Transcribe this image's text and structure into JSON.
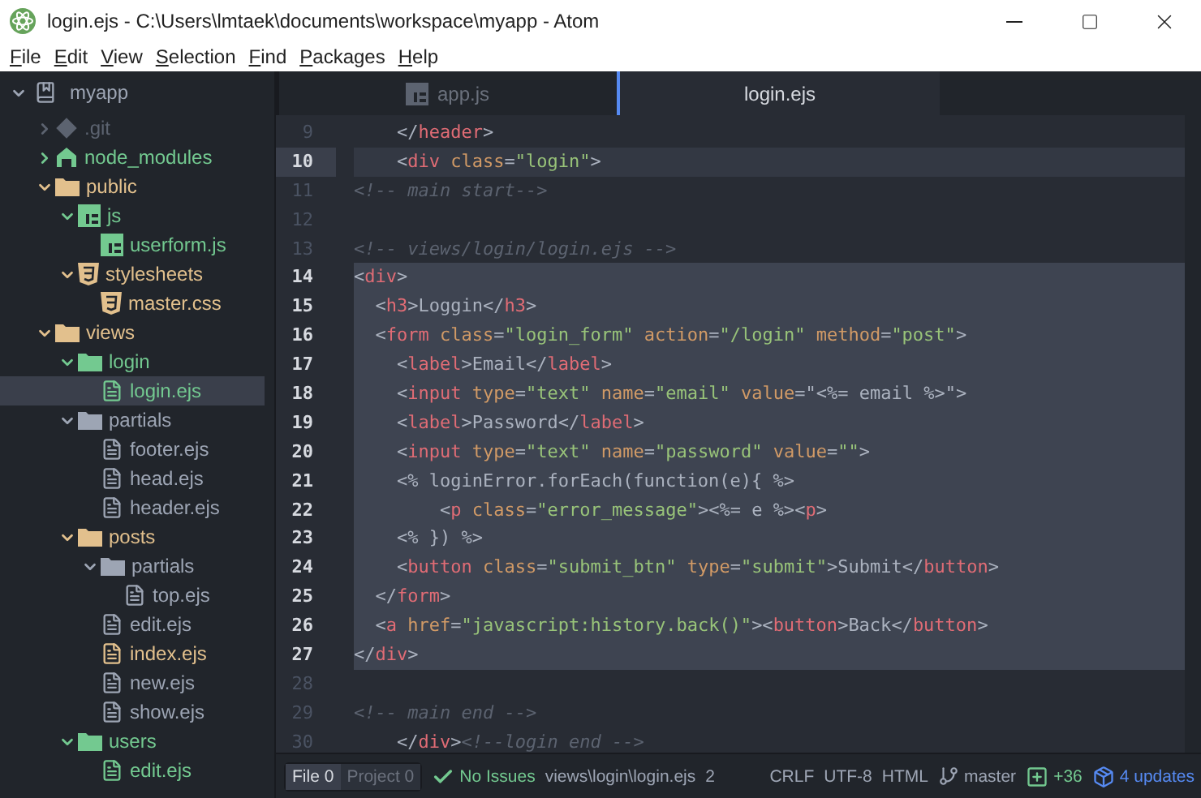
{
  "window": {
    "title": "login.ejs - C:\\Users\\lmtaek\\documents\\workspace\\myapp - Atom"
  },
  "menu": [
    "File",
    "Edit",
    "View",
    "Selection",
    "Find",
    "Packages",
    "Help"
  ],
  "tree": {
    "root": {
      "label": "myapp",
      "expanded": true,
      "selected": false
    },
    "items": [
      {
        "label": ".git",
        "kind": "git",
        "color": "#5c6370",
        "expanded": false,
        "selected": false
      },
      {
        "label": "node_modules",
        "kind": "modules",
        "color": "#73c990",
        "expanded": false,
        "selected": false
      },
      {
        "label": "public",
        "kind": "folder",
        "color": "#e2c08d",
        "expanded": true,
        "selected": false,
        "children": [
          {
            "label": "js",
            "kind": "scripts",
            "color": "#73c990",
            "expanded": true,
            "selected": false,
            "children": [
              {
                "label": "userform.js",
                "kind": "script",
                "color": "#73c990",
                "selected": false
              }
            ]
          },
          {
            "label": "stylesheets",
            "kind": "styles",
            "color": "#e2c08d",
            "expanded": true,
            "selected": false,
            "children": [
              {
                "label": "master.css",
                "kind": "stylesheet",
                "color": "#e2c08d",
                "selected": false
              }
            ]
          }
        ]
      },
      {
        "label": "views",
        "kind": "folder",
        "color": "#e2c08d",
        "expanded": true,
        "selected": false,
        "children": [
          {
            "label": "login",
            "kind": "folder",
            "color": "#73c990",
            "expanded": true,
            "selected": false,
            "children": [
              {
                "label": "login.ejs",
                "kind": "document",
                "color": "#73c990",
                "selected": true
              }
            ]
          },
          {
            "label": "partials",
            "kind": "folder",
            "color": "#9da5b4",
            "expanded": true,
            "selected": false,
            "children": [
              {
                "label": "footer.ejs",
                "kind": "document",
                "color": "#9da5b4",
                "selected": false
              },
              {
                "label": "head.ejs",
                "kind": "document",
                "color": "#9da5b4",
                "selected": false
              },
              {
                "label": "header.ejs",
                "kind": "document",
                "color": "#9da5b4",
                "selected": false
              }
            ]
          },
          {
            "label": "posts",
            "kind": "folder",
            "color": "#e2c08d",
            "expanded": true,
            "selected": false,
            "children": [
              {
                "label": "partials",
                "kind": "folder",
                "color": "#9da5b4",
                "expanded": true,
                "selected": false,
                "children": [
                  {
                    "label": "top.ejs",
                    "kind": "document",
                    "color": "#9da5b4",
                    "selected": false
                  }
                ]
              },
              {
                "label": "edit.ejs",
                "kind": "document",
                "color": "#9da5b4",
                "selected": false
              },
              {
                "label": "index.ejs",
                "kind": "document",
                "color": "#e2c08d",
                "selected": false
              },
              {
                "label": "new.ejs",
                "kind": "document",
                "color": "#9da5b4",
                "selected": false
              },
              {
                "label": "show.ejs",
                "kind": "document",
                "color": "#9da5b4",
                "selected": false
              }
            ]
          },
          {
            "label": "users",
            "kind": "folder",
            "color": "#73c990",
            "expanded": true,
            "selected": false,
            "children": [
              {
                "label": "edit.ejs",
                "kind": "document",
                "color": "#73c990",
                "selected": false
              }
            ]
          }
        ]
      }
    ]
  },
  "tabs": [
    {
      "label": "app.js",
      "kind": "script",
      "selected": false
    },
    {
      "label": "login.ejs",
      "kind": "document",
      "selected": true
    }
  ],
  "editor": {
    "lines": [
      {
        "number": "9",
        "cursor": false,
        "selected": false,
        "tokens": [
          {
            "kind": "punct",
            "text": "    </"
          },
          {
            "kind": "tag",
            "text": "header"
          },
          {
            "kind": "punct",
            "text": ">"
          }
        ]
      },
      {
        "number": "10",
        "cursor": true,
        "selected": false,
        "tokens": [
          {
            "kind": "punct",
            "text": "    <"
          },
          {
            "kind": "tag",
            "text": "div"
          },
          {
            "kind": "attr",
            "text": " class"
          },
          {
            "kind": "punct",
            "text": "="
          },
          {
            "kind": "string",
            "text": "\"login\""
          },
          {
            "kind": "punct",
            "text": ">"
          }
        ]
      },
      {
        "number": "11",
        "cursor": false,
        "selected": false,
        "tokens": [
          {
            "kind": "comment",
            "text": "<!-- main start-->"
          }
        ]
      },
      {
        "number": "12",
        "cursor": false,
        "selected": false
      },
      {
        "number": "13",
        "cursor": false,
        "selected": false,
        "tokens": [
          {
            "kind": "comment",
            "text": "<!-- views/login/login.ejs -->"
          }
        ]
      },
      {
        "number": "14",
        "cursor": false,
        "selected": true,
        "tokens": [
          {
            "kind": "punct",
            "text": "<"
          },
          {
            "kind": "tag",
            "text": "div"
          },
          {
            "kind": "punct",
            "text": ">"
          }
        ]
      },
      {
        "number": "15",
        "cursor": false,
        "selected": true,
        "tokens": [
          {
            "kind": "punct",
            "text": "  <"
          },
          {
            "kind": "tag",
            "text": "h3"
          },
          {
            "kind": "punct",
            "text": ">"
          },
          {
            "kind": "text",
            "text": "Loggin"
          },
          {
            "kind": "punct",
            "text": "</"
          },
          {
            "kind": "tag",
            "text": "h3"
          },
          {
            "kind": "punct",
            "text": ">"
          }
        ]
      },
      {
        "number": "16",
        "cursor": false,
        "selected": true,
        "tokens": [
          {
            "kind": "punct",
            "text": "  <"
          },
          {
            "kind": "tag",
            "text": "form"
          },
          {
            "kind": "attr",
            "text": " class"
          },
          {
            "kind": "punct",
            "text": "="
          },
          {
            "kind": "string",
            "text": "\"login_form\""
          },
          {
            "kind": "attr",
            "text": " action"
          },
          {
            "kind": "punct",
            "text": "="
          },
          {
            "kind": "string",
            "text": "\"/login\""
          },
          {
            "kind": "attr",
            "text": " method"
          },
          {
            "kind": "punct",
            "text": "="
          },
          {
            "kind": "string",
            "text": "\"post\""
          },
          {
            "kind": "punct",
            "text": ">"
          }
        ]
      },
      {
        "number": "17",
        "cursor": false,
        "selected": true,
        "tokens": [
          {
            "kind": "punct",
            "text": "    <"
          },
          {
            "kind": "tag",
            "text": "label"
          },
          {
            "kind": "punct",
            "text": ">"
          },
          {
            "kind": "text",
            "text": "Email"
          },
          {
            "kind": "punct",
            "text": "</"
          },
          {
            "kind": "tag",
            "text": "label"
          },
          {
            "kind": "punct",
            "text": ">"
          }
        ]
      },
      {
        "number": "18",
        "cursor": false,
        "selected": true,
        "tokens": [
          {
            "kind": "punct",
            "text": "    <"
          },
          {
            "kind": "tag",
            "text": "input"
          },
          {
            "kind": "attr",
            "text": " type"
          },
          {
            "kind": "punct",
            "text": "="
          },
          {
            "kind": "string",
            "text": "\"text\""
          },
          {
            "kind": "attr",
            "text": " name"
          },
          {
            "kind": "punct",
            "text": "="
          },
          {
            "kind": "string",
            "text": "\"email\""
          },
          {
            "kind": "attr",
            "text": " value"
          },
          {
            "kind": "punct",
            "text": "=\""
          },
          {
            "kind": "text",
            "text": "<%= email %>"
          },
          {
            "kind": "punct",
            "text": "\">"
          }
        ]
      },
      {
        "number": "19",
        "cursor": false,
        "selected": true,
        "tokens": [
          {
            "kind": "punct",
            "text": "    <"
          },
          {
            "kind": "tag",
            "text": "label"
          },
          {
            "kind": "punct",
            "text": ">"
          },
          {
            "kind": "text",
            "text": "Password"
          },
          {
            "kind": "punct",
            "text": "</"
          },
          {
            "kind": "tag",
            "text": "label"
          },
          {
            "kind": "punct",
            "text": ">"
          }
        ]
      },
      {
        "number": "20",
        "cursor": false,
        "selected": true,
        "tokens": [
          {
            "kind": "punct",
            "text": "    <"
          },
          {
            "kind": "tag",
            "text": "input"
          },
          {
            "kind": "attr",
            "text": " type"
          },
          {
            "kind": "punct",
            "text": "="
          },
          {
            "kind": "string",
            "text": "\"text\""
          },
          {
            "kind": "attr",
            "text": " name"
          },
          {
            "kind": "punct",
            "text": "="
          },
          {
            "kind": "string",
            "text": "\"password\""
          },
          {
            "kind": "attr",
            "text": " value"
          },
          {
            "kind": "punct",
            "text": "="
          },
          {
            "kind": "string",
            "text": "\"\""
          },
          {
            "kind": "punct",
            "text": ">"
          }
        ]
      },
      {
        "number": "21",
        "cursor": false,
        "selected": true,
        "tokens": [
          {
            "kind": "text",
            "text": "    <% loginError.forEach(function(e){ %>"
          }
        ]
      },
      {
        "number": "22",
        "cursor": false,
        "selected": true,
        "tokens": [
          {
            "kind": "punct",
            "text": "        <"
          },
          {
            "kind": "tag",
            "text": "p"
          },
          {
            "kind": "attr",
            "text": " class"
          },
          {
            "kind": "punct",
            "text": "="
          },
          {
            "kind": "string",
            "text": "\"error_message\""
          },
          {
            "kind": "punct",
            "text": ">"
          },
          {
            "kind": "text",
            "text": "<%= e %>"
          },
          {
            "kind": "punct",
            "text": "<"
          },
          {
            "kind": "tag",
            "text": "p"
          },
          {
            "kind": "punct",
            "text": ">"
          }
        ]
      },
      {
        "number": "23",
        "cursor": false,
        "selected": true,
        "tokens": [
          {
            "kind": "text",
            "text": "    <% }) %>"
          }
        ]
      },
      {
        "number": "24",
        "cursor": false,
        "selected": true,
        "tokens": [
          {
            "kind": "punct",
            "text": "    <"
          },
          {
            "kind": "tag",
            "text": "button"
          },
          {
            "kind": "attr",
            "text": " class"
          },
          {
            "kind": "punct",
            "text": "="
          },
          {
            "kind": "string",
            "text": "\"submit_btn\""
          },
          {
            "kind": "attr",
            "text": " type"
          },
          {
            "kind": "punct",
            "text": "="
          },
          {
            "kind": "string",
            "text": "\"submit\""
          },
          {
            "kind": "punct",
            "text": ">"
          },
          {
            "kind": "text",
            "text": "Submit"
          },
          {
            "kind": "punct",
            "text": "</"
          },
          {
            "kind": "tag",
            "text": "button"
          },
          {
            "kind": "punct",
            "text": ">"
          }
        ]
      },
      {
        "number": "25",
        "cursor": false,
        "selected": true,
        "tokens": [
          {
            "kind": "punct",
            "text": "  </"
          },
          {
            "kind": "tag",
            "text": "form"
          },
          {
            "kind": "punct",
            "text": ">"
          }
        ]
      },
      {
        "number": "26",
        "cursor": false,
        "selected": true,
        "tokens": [
          {
            "kind": "punct",
            "text": "  <"
          },
          {
            "kind": "tag",
            "text": "a"
          },
          {
            "kind": "attr",
            "text": " href"
          },
          {
            "kind": "punct",
            "text": "="
          },
          {
            "kind": "string",
            "text": "\"javascript:history.back()\""
          },
          {
            "kind": "punct",
            "text": "><"
          },
          {
            "kind": "tag",
            "text": "button"
          },
          {
            "kind": "punct",
            "text": ">"
          },
          {
            "kind": "text",
            "text": "Back"
          },
          {
            "kind": "punct",
            "text": "</"
          },
          {
            "kind": "tag",
            "text": "button"
          },
          {
            "kind": "punct",
            "text": ">"
          }
        ]
      },
      {
        "number": "27",
        "cursor": false,
        "selected": true,
        "tokens": [
          {
            "kind": "punct",
            "text": "</"
          },
          {
            "kind": "tag",
            "text": "div"
          },
          {
            "kind": "punct",
            "text": ">"
          }
        ]
      },
      {
        "number": "28",
        "cursor": false,
        "selected": false
      },
      {
        "number": "29",
        "cursor": false,
        "selected": false,
        "tokens": [
          {
            "kind": "comment",
            "text": "<!-- main end -->"
          }
        ]
      },
      {
        "number": "30",
        "cursor": false,
        "selected": false,
        "tokens": [
          {
            "kind": "punct",
            "text": "    </"
          },
          {
            "kind": "tag",
            "text": "div"
          },
          {
            "kind": "punct",
            "text": ">"
          },
          {
            "kind": "comment",
            "text": "<!--login end -->"
          }
        ]
      }
    ]
  },
  "status_bar": {
    "panels": [
      {
        "label": "File",
        "count": "0",
        "selected": true
      },
      {
        "label": "Project",
        "count": "0",
        "selected": false
      }
    ],
    "linter": "No Issues",
    "path": "views\\login\\login.ejs",
    "selection": "2",
    "line_ending": "CRLF",
    "encoding": "UTF-8",
    "grammar": "HTML",
    "branch": "master",
    "diff": "+36",
    "updates": "4 updates"
  }
}
